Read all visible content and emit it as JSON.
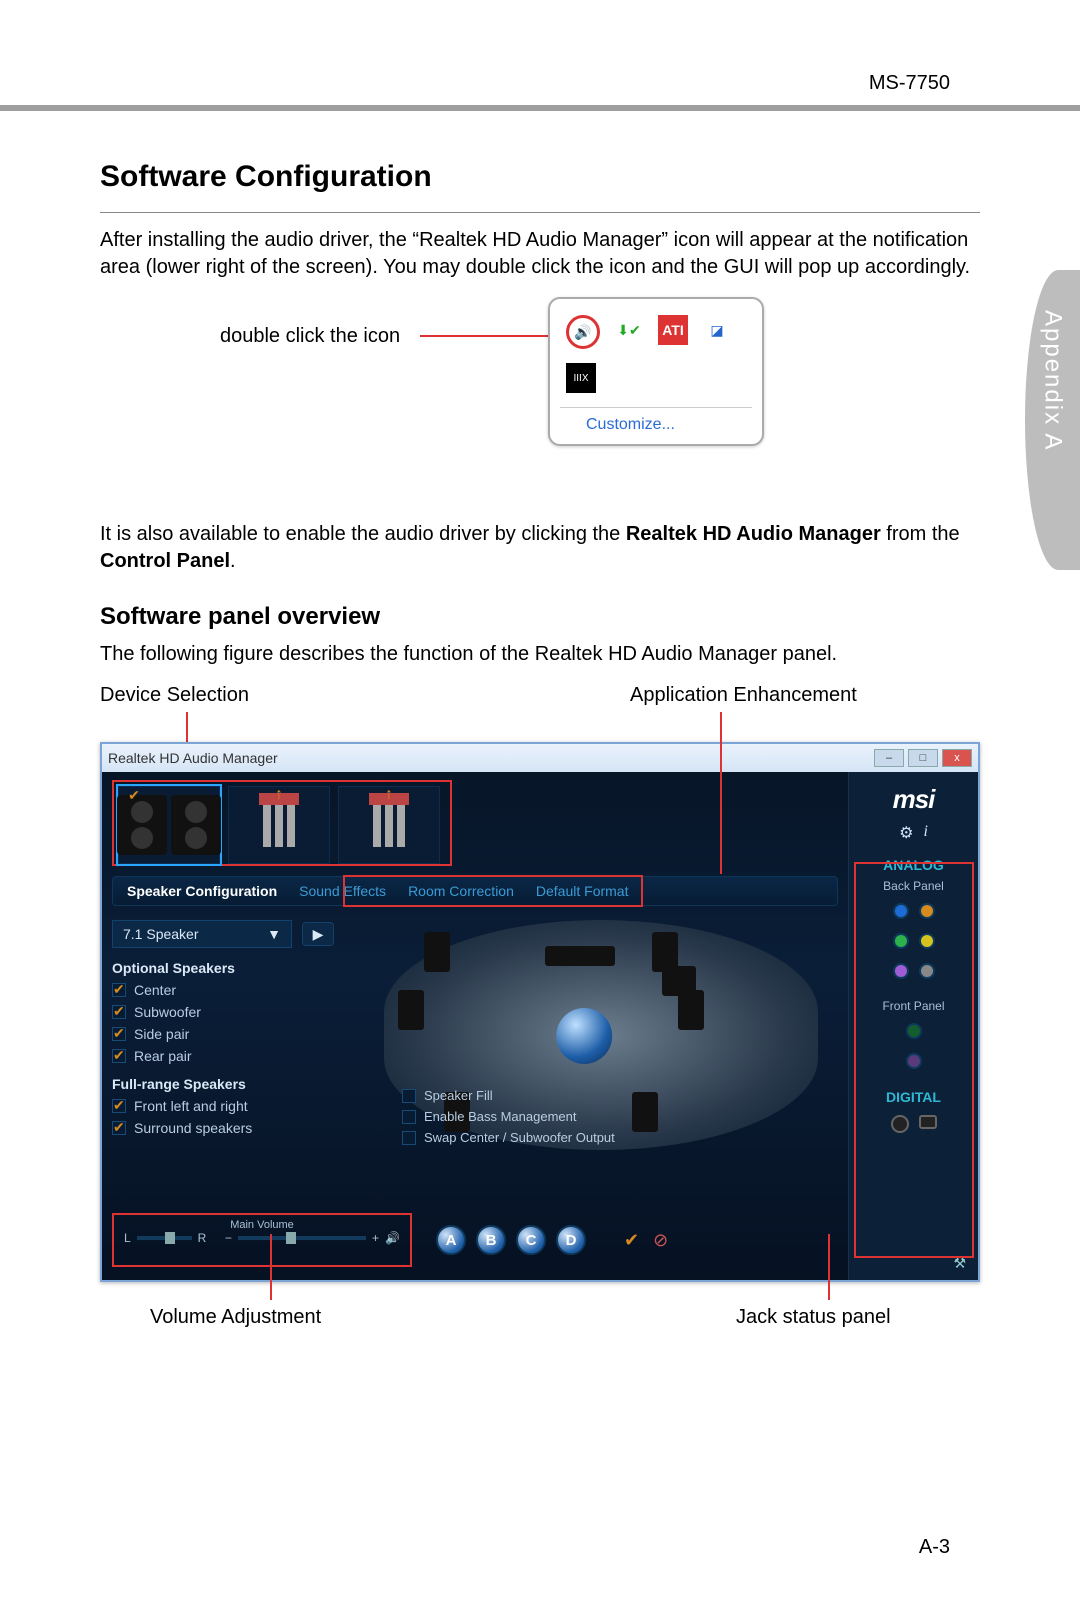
{
  "model": "MS-7750",
  "appendix_label": "Appendix A",
  "page_number": "A-3",
  "h1": "Software Configuration",
  "para1": "After installing the audio driver, the “Realtek HD Audio Manager” icon will appear at the notification area (lower right of the screen). You may double click the icon and the GUI will pop up accordingly.",
  "tray": {
    "caption": "double click the icon",
    "customize": "Customize...",
    "icons": [
      "realtek",
      "device-ok",
      "ati",
      "display",
      "thx"
    ]
  },
  "para2_pre": "It is also available to enable the audio driver by clicking the ",
  "para2_b1": "Realtek HD Audio Manager",
  "para2_mid": " from the ",
  "para2_b2": "Control Panel",
  "para2_post": ".",
  "h2": "Software panel overview",
  "para3": "The following figure describes the function of the Realtek HD Audio Manager panel.",
  "callouts": {
    "device_selection": "Device Selection",
    "app_enhancement": "Application Enhancement",
    "volume_adjustment": "Volume Adjustment",
    "jack_status": "Jack status panel"
  },
  "am": {
    "title": "Realtek HD Audio Manager",
    "window_min": "–",
    "window_max": "□",
    "window_close": "x",
    "logo": "msi",
    "tabs": {
      "speaker_config": "Speaker Configuration",
      "sound_effects": "Sound Effects",
      "room_correction": "Room Correction",
      "default_format": "Default Format"
    },
    "select_label": "7.1 Speaker",
    "select_caret": "▼",
    "play": "▶",
    "optional_h": "Optional Speakers",
    "opts": {
      "center": "Center",
      "sub": "Subwoofer",
      "side": "Side pair",
      "rear": "Rear pair"
    },
    "full_h": "Full-range Speakers",
    "full": {
      "flr": "Front left and right",
      "surr": "Surround speakers"
    },
    "rt_checks": {
      "fill": "Speaker Fill",
      "bass": "Enable Bass Management",
      "swap": "Swap Center / Subwoofer Output"
    },
    "volume": {
      "label": "Main Volume",
      "L": "L",
      "R": "R",
      "minus": "−",
      "plus": "+",
      "spk": "◀︎))"
    },
    "abcd": {
      "a": "A",
      "b": "B",
      "c": "C",
      "d": "D"
    },
    "ok": "✔",
    "no": "⊘",
    "side": {
      "analog": "ANALOG",
      "back": "Back Panel",
      "front": "Front Panel",
      "digital": "DIGITAL",
      "gear": "⚙",
      "info": "i",
      "wrench": "⚒"
    }
  }
}
